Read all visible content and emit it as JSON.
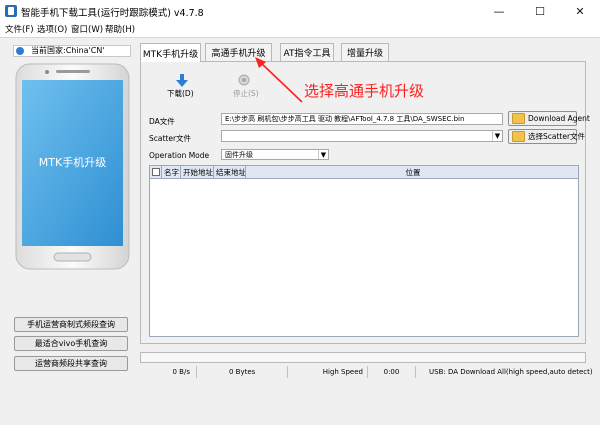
{
  "window": {
    "title": "智能手机下载工具(运行时跟踪模式)  v4.7.8",
    "minimize": "—",
    "maximize": "☐",
    "close": "✕"
  },
  "menu": {
    "items": [
      "文件(F)",
      "选项(O)",
      "窗口(W)",
      "帮助(H)"
    ]
  },
  "left_panel": {
    "country": "当前国家:China'CN'",
    "phone_screen_text": "MTK手机升级",
    "buttons": [
      "手机运营商制式频段查询",
      "最适合vivo手机查询",
      "运营商频段共享查询"
    ]
  },
  "tabs": [
    {
      "label": "MTK手机升级",
      "active": true
    },
    {
      "label": "高通手机升级",
      "active": false
    },
    {
      "label": "AT指令工具",
      "active": false
    },
    {
      "label": "增量升级",
      "active": false
    }
  ],
  "toolbar": {
    "download_label": "下载(D)",
    "stop_label": "停止(S)"
  },
  "annotation": {
    "text": "选择高通手机升级",
    "color": "#ff2020"
  },
  "form": {
    "da_label": "DA文件",
    "da_value": "E:\\步步高 刷机包\\步步高工具 驱动 教程\\AFTool_4.7.8 工具\\DA_SWSEC.bin",
    "download_agent_button": "Download Agent",
    "scatter_label": "Scatter文件",
    "scatter_value": "",
    "scatter_button": "选择Scatter文件",
    "mode_label": "Operation Mode",
    "mode_value": "固件升级"
  },
  "table": {
    "columns": [
      "名字",
      "开始地址",
      "结束地址",
      "位置"
    ]
  },
  "status": {
    "speed": "0 B/s",
    "bytes": "0 Bytes",
    "link_speed": "High Speed",
    "time": "0:00",
    "message": "USB: DA Download All(high speed,auto detect)"
  }
}
